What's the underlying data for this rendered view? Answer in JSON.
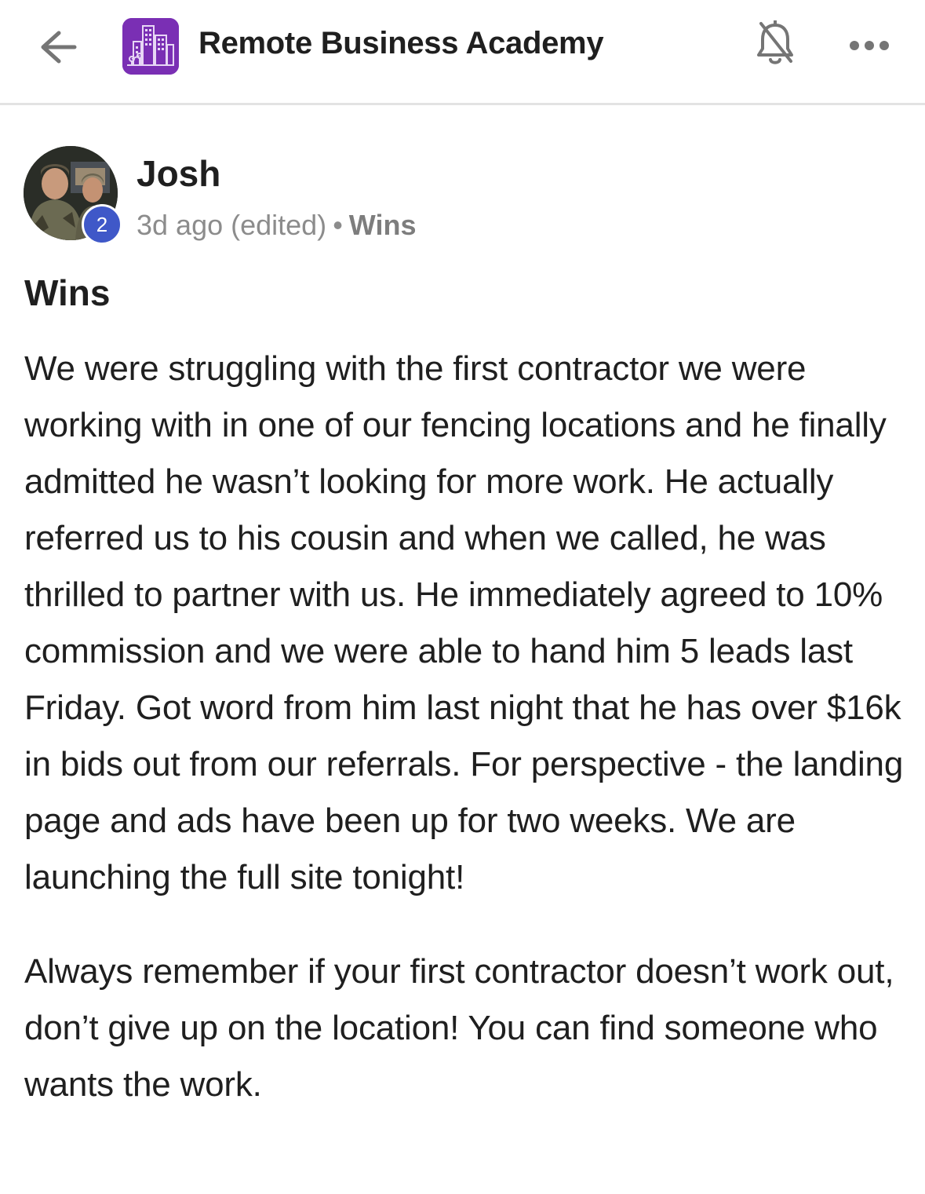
{
  "header": {
    "title": "Remote Business Academy",
    "back_icon": "arrow-left-icon",
    "logo_icon": "city-buildings-logo",
    "bell_icon": "bell-off-icon",
    "more_icon": "more-horizontal-icon",
    "logo_color": "#7a2fb4"
  },
  "post": {
    "author": "Josh",
    "level": "2",
    "time": "3d ago (edited)",
    "separator": "•",
    "category": "Wins",
    "title": "Wins",
    "paragraphs": [
      "We were struggling with the first contractor we were working with in one of our fencing locations and he finally admitted he wasn’t looking for more work. He actually referred us to his cousin and when we called, he was thrilled to partner with us. He immediately agreed to 10% commission and we were able to hand him 5 leads last Friday. Got word from him last night that he has over $16k in bids out from our referrals. For perspective - the landing page and ads have been up for two weeks. We are launching the full site tonight!",
      "Always remember if your first contractor doesn’t work out, don’t give up on the location! You can find someone who wants the work."
    ]
  },
  "colors": {
    "text": "#1f1f1f",
    "meta": "#8c8c8c",
    "badge": "#3f58c8",
    "divider": "#e3e3e3"
  }
}
